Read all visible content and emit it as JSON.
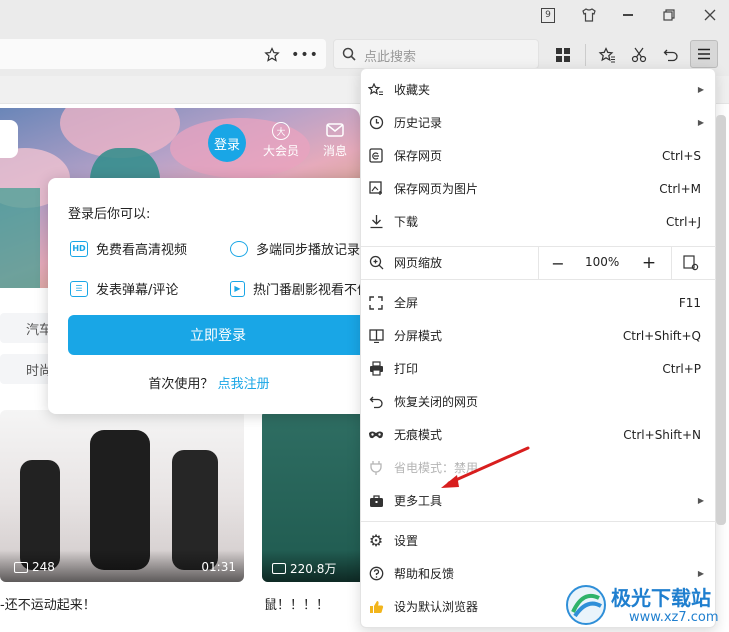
{
  "titlebar": {
    "badge": "9"
  },
  "search": {
    "placeholder": "点此搜索"
  },
  "header": {
    "login": "登录",
    "vip": "大会员",
    "messages": "消息"
  },
  "popup": {
    "title": "登录后你可以:",
    "features": [
      {
        "icon": "HD",
        "label": "免费看高清视频"
      },
      {
        "icon": "clock",
        "label": "多端同步播放记录"
      },
      {
        "icon": "danmaku",
        "label": "发表弹幕/评论"
      },
      {
        "icon": "play",
        "label": "热门番剧影视看不停"
      }
    ],
    "login_button": "立即登录",
    "first_use": "首次使用？",
    "register_link": "点我注册"
  },
  "chips": [
    "汽车",
    "时尚"
  ],
  "videos": [
    {
      "views": "248",
      "duration": "01:31",
      "title": "-还不运动起来！"
    },
    {
      "views": "220.8万",
      "title": "鼠！！！！"
    }
  ],
  "menu": {
    "items": [
      {
        "id": "favorites",
        "icon": "star-list-icon",
        "label": "收藏夹",
        "arrow": "▶"
      },
      {
        "id": "history",
        "icon": "clock-icon",
        "label": "历史记录",
        "arrow": "▶"
      },
      {
        "id": "save-page",
        "icon": "save-page-icon",
        "label": "保存网页",
        "shortcut": "Ctrl+S"
      },
      {
        "id": "save-as-image",
        "icon": "image-icon",
        "label": "保存网页为图片",
        "shortcut": "Ctrl+M"
      },
      {
        "id": "downloads",
        "icon": "download-icon",
        "label": "下载",
        "shortcut": "Ctrl+J"
      }
    ],
    "zoom": {
      "label": "网页缩放",
      "minus": "−",
      "value": "100%",
      "plus": "+"
    },
    "items2": [
      {
        "id": "fullscreen",
        "icon": "fullscreen-icon",
        "label": "全屏",
        "shortcut": "F11"
      },
      {
        "id": "split-screen",
        "icon": "split-screen-icon",
        "label": "分屏模式",
        "shortcut": "Ctrl+Shift+Q"
      },
      {
        "id": "print",
        "icon": "printer-icon",
        "label": "打印",
        "shortcut": "Ctrl+P"
      },
      {
        "id": "restore-closed",
        "icon": "undo-icon",
        "label": "恢复关闭的网页"
      },
      {
        "id": "incognito",
        "icon": "mask-icon",
        "label": "无痕模式",
        "shortcut": "Ctrl+Shift+N"
      },
      {
        "id": "power-save",
        "icon": "plug-icon",
        "label": "省电模式：禁用"
      },
      {
        "id": "more-tools",
        "icon": "toolbox-icon",
        "label": "更多工具",
        "arrow": "▶"
      }
    ],
    "items3": [
      {
        "id": "settings",
        "icon": "gear-icon",
        "label": "设置"
      },
      {
        "id": "help-feedback",
        "icon": "help-icon",
        "label": "帮助和反馈",
        "arrow": "▶"
      },
      {
        "id": "default-browser",
        "icon": "thumb-icon",
        "label": "设为默认浏览器"
      }
    ]
  },
  "watermark": {
    "name": "极光下载站",
    "url": "www.xz7.com"
  },
  "colors": {
    "accent": "#19a6e6",
    "annotation": "#d81e1e"
  }
}
